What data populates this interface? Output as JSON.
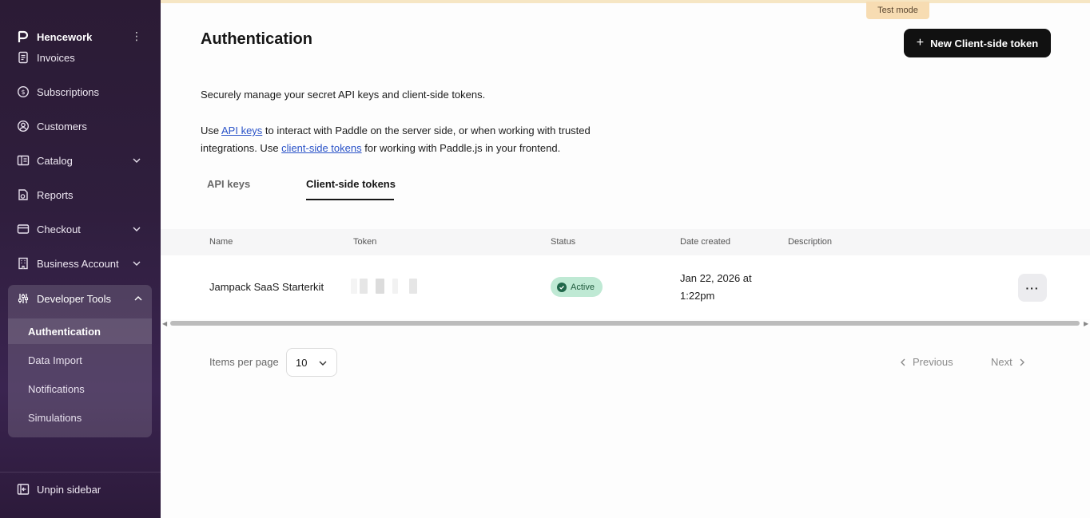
{
  "sidebar": {
    "brand": "Hencework",
    "items": [
      {
        "label": "Invoices"
      },
      {
        "label": "Subscriptions"
      },
      {
        "label": "Customers"
      },
      {
        "label": "Catalog"
      },
      {
        "label": "Reports"
      },
      {
        "label": "Checkout"
      },
      {
        "label": "Business Account"
      }
    ],
    "developer_tools": {
      "label": "Developer Tools",
      "sub_items": [
        {
          "label": "Authentication"
        },
        {
          "label": "Data Import"
        },
        {
          "label": "Notifications"
        },
        {
          "label": "Simulations"
        }
      ]
    },
    "unpin_label": "Unpin sidebar"
  },
  "header": {
    "test_mode": "Test mode",
    "title": "Authentication",
    "new_token_label": "New Client-side token"
  },
  "description": {
    "line1": "Securely manage your secret API keys and client-side tokens.",
    "use": "Use ",
    "api_keys_link": "API keys",
    "mid": " to interact with Paddle on the server side, or when working with trusted integrations. Use ",
    "client_link": "client-side tokens",
    "end": " for working with Paddle.js in your frontend."
  },
  "tabs": [
    {
      "label": "API keys"
    },
    {
      "label": "Client-side tokens",
      "active": true
    }
  ],
  "table": {
    "columns": [
      "Name",
      "Token",
      "Status",
      "Date created",
      "Description"
    ],
    "rows": [
      {
        "name": "Jampack SaaS Starterkit",
        "status": "Active",
        "date_line1": "Jan 22, 2026 at",
        "date_line2": "1:22pm",
        "description": ""
      }
    ]
  },
  "pagination": {
    "items_per_page_label": "Items per page",
    "items_per_page_value": "10",
    "previous": "Previous",
    "next": "Next"
  },
  "colors": {
    "sidebar_bg": "#2f1e3d",
    "primary_button": "#111111",
    "status_active": "#bfe9d4",
    "link": "#2952c8",
    "test_mode_badge": "#f7dcb2"
  }
}
